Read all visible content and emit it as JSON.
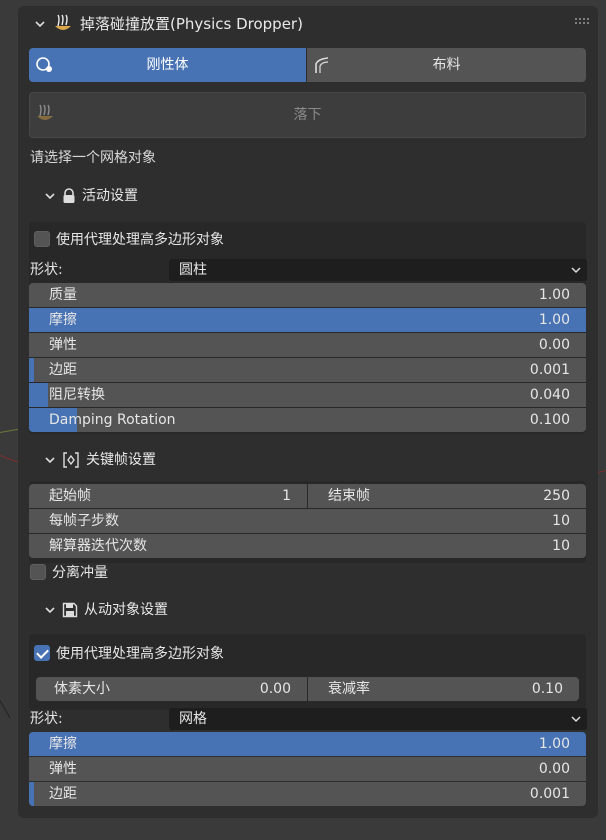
{
  "panel": {
    "title": "掉落碰撞放置(Physics Dropper)",
    "tabs": [
      {
        "label": "刚性体",
        "icon": "rigidbody-icon",
        "active": true
      },
      {
        "label": "布料",
        "icon": "cloth-icon",
        "active": false
      }
    ],
    "drop_button": {
      "label": "落下",
      "icon": "physics-dropper-icon",
      "enabled": false
    },
    "hint": "请选择一个网格对象"
  },
  "active_settings": {
    "title": "活动设置",
    "icon": "lock-icon",
    "proxy_checkbox": {
      "label": "使用代理处理高多边形对象",
      "checked": false
    },
    "shape": {
      "label": "形状:",
      "value": "圆柱"
    },
    "fields": [
      {
        "label": "质量",
        "value": "1.00",
        "fill": 0,
        "selected": false
      },
      {
        "label": "摩擦",
        "value": "1.00",
        "fill": 1,
        "selected": true
      },
      {
        "label": "弹性",
        "value": "0.00",
        "fill": 0,
        "selected": false
      },
      {
        "label": "边距",
        "value": "0.001",
        "fill": 0.01,
        "selected": false
      },
      {
        "label": "阻尼转换",
        "value": "0.040",
        "fill": 0.04,
        "selected": false
      },
      {
        "label": "Damping  Rotation",
        "value": "0.100",
        "fill": 0.1,
        "selected": false
      }
    ]
  },
  "keyframe_settings": {
    "title": "关键帧设置",
    "icon": "keyframe-icon",
    "start_frame": {
      "label": "起始帧",
      "value": "1"
    },
    "end_frame": {
      "label": "结束帧",
      "value": "250"
    },
    "substeps": {
      "label": "每帧子步数",
      "value": "10"
    },
    "solver_iterations": {
      "label": "解算器迭代次数",
      "value": "10"
    },
    "split_impulse": {
      "label": "分离冲量",
      "checked": false
    }
  },
  "passive_settings": {
    "title": "从动对象设置",
    "icon": "save-icon",
    "proxy_checkbox": {
      "label": "使用代理处理高多边形对象",
      "checked": true
    },
    "voxel_size": {
      "label": "体素大小",
      "value": "0.00"
    },
    "decimate": {
      "label": "衰减率",
      "value": "0.10"
    },
    "shape": {
      "label": "形状:",
      "value": "网格"
    },
    "fields": [
      {
        "label": "摩擦",
        "value": "1.00",
        "fill": 1,
        "selected": true
      },
      {
        "label": "弹性",
        "value": "0.00",
        "fill": 0,
        "selected": false
      },
      {
        "label": "边距",
        "value": "0.001",
        "fill": 0.01,
        "selected": false
      }
    ]
  },
  "colors": {
    "accent": "#4772b3",
    "panel_bg": "#2e2e2e",
    "field_bg": "#545454",
    "viewport_bg": "#3a3a3a"
  }
}
